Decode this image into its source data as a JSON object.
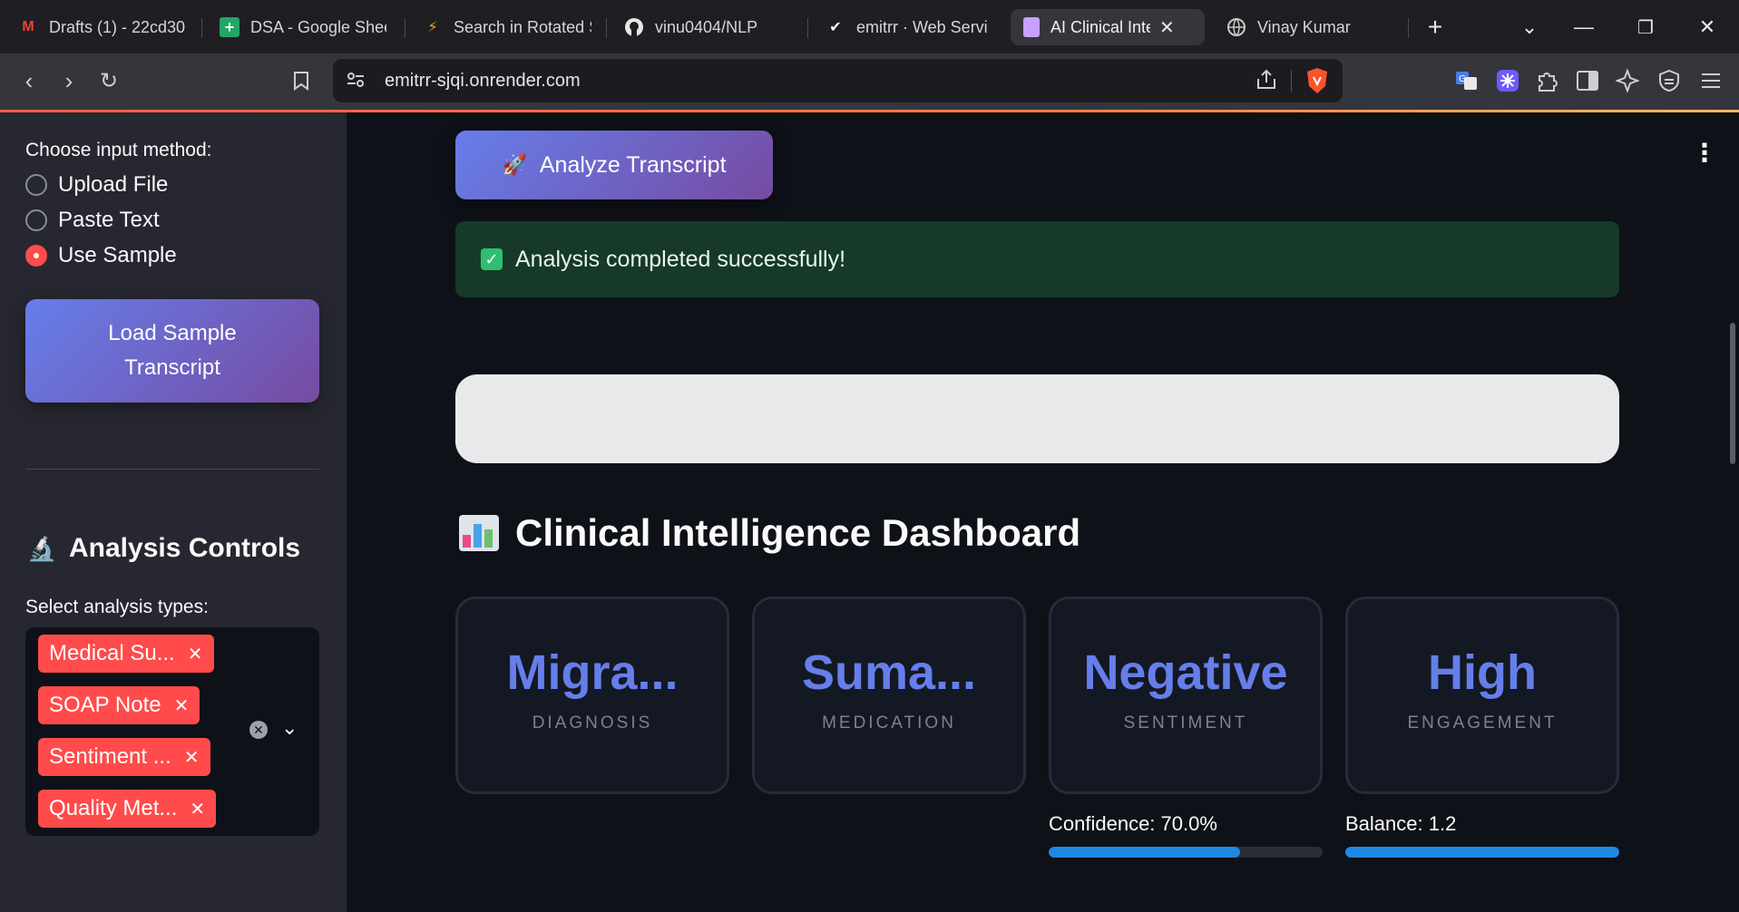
{
  "browser": {
    "tabs": [
      {
        "title": "Drafts (1) - 22cd30",
        "icon": "gmail-icon"
      },
      {
        "title": "DSA - Google Shee",
        "icon": "sheets-icon"
      },
      {
        "title": "Search in Rotated S",
        "icon": "search-icon"
      },
      {
        "title": "vinu0404/NLP",
        "icon": "github-icon"
      },
      {
        "title": "emitrr · Web Servi",
        "icon": "render-icon"
      },
      {
        "title": "AI Clinical Inte",
        "icon": "streamlit-icon",
        "active": true
      },
      {
        "title": "Vinay Kumar",
        "icon": "globe-icon"
      }
    ],
    "url": "emitrr-sjqi.onrender.com"
  },
  "sidebar": {
    "input_label": "Choose input method:",
    "options": [
      {
        "label": "Upload File",
        "selected": false
      },
      {
        "label": "Paste Text",
        "selected": false
      },
      {
        "label": "Use Sample",
        "selected": true
      }
    ],
    "load_button": "Load Sample Transcript",
    "controls_heading": "Analysis Controls",
    "controls_icon": "microscope-icon",
    "types_label": "Select analysis types:",
    "selected_types": [
      "Medical Su...",
      "SOAP Note",
      "Sentiment ...",
      "Quality Met..."
    ]
  },
  "main": {
    "analyze_button": "Analyze Transcript",
    "analyze_icon": "rocket-icon",
    "success_message": "Analysis completed successfully!",
    "dashboard_title": "Clinical Intelligence Dashboard",
    "dashboard_icon": "bar-chart-icon",
    "cards": [
      {
        "value": "Migra...",
        "label": "DIAGNOSIS"
      },
      {
        "value": "Suma...",
        "label": "MEDICATION"
      },
      {
        "value": "Negative",
        "label": "SENTIMENT"
      },
      {
        "value": "High",
        "label": "ENGAGEMENT"
      }
    ],
    "metrics": [
      {
        "label": "Confidence: 70.0%",
        "progress": 0.7
      },
      {
        "label": "Balance: 1.2",
        "progress": 1.0
      }
    ]
  },
  "colors": {
    "accent": "#667eea",
    "accent_end": "#764ba2",
    "chip": "#ff4b4b",
    "success_bg": "#173928",
    "progress": "#1e88e5"
  }
}
